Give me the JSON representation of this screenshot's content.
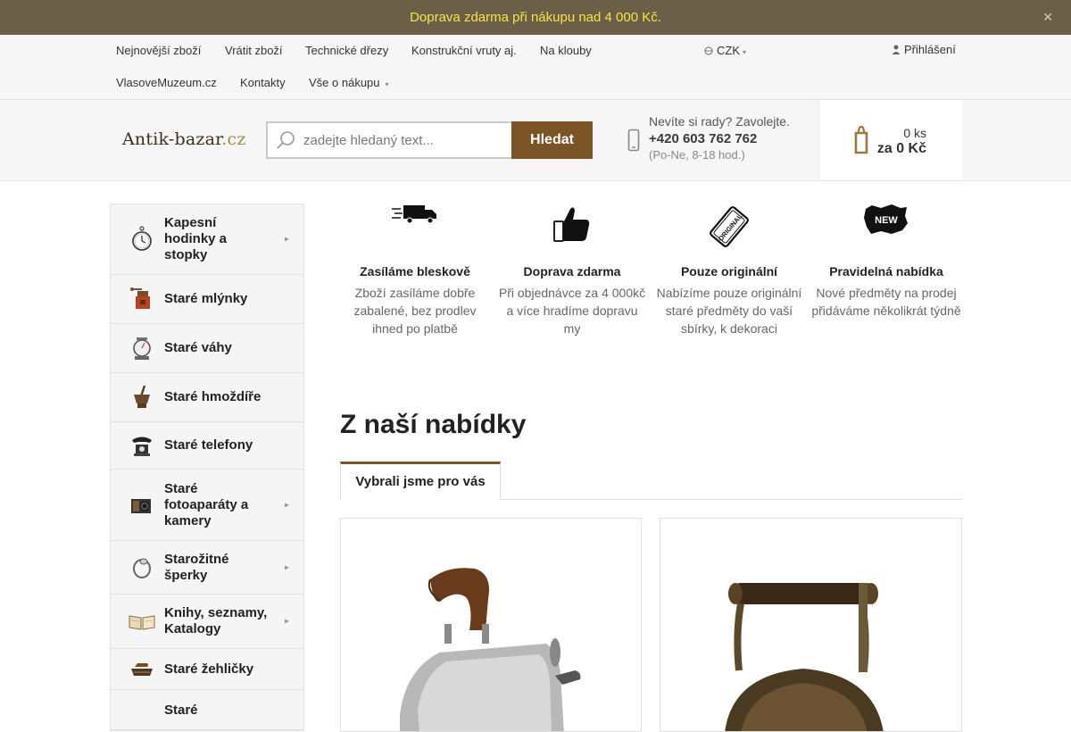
{
  "promo": {
    "text": "Doprava zdarma při nákupu nad 4 000 Kč.",
    "close": "✕"
  },
  "nav": {
    "row1": [
      "Nejnovější zboží",
      "Vrátit zboží",
      "Technické dřezy",
      "Konstrukční vruty aj.",
      "Na klouby"
    ],
    "row2": [
      "VlasoveMuzeum.cz",
      "Kontakty",
      "Vše o nákupu"
    ],
    "currency": "CZK",
    "login": "Přihlášení"
  },
  "header": {
    "logo_main": "Antik-bazar",
    "logo_tld": ".cz",
    "search_placeholder": "zadejte hledaný text...",
    "search_button": "Hledat",
    "contact_question": "Nevíte si rady? Zavolejte.",
    "contact_phone": "+420 603 762 762",
    "contact_hours": "(Po-Ne, 8-18 hod.)",
    "cart_count": "0 ks",
    "cart_total": "za 0 Kč"
  },
  "sidebar": {
    "items": [
      {
        "label": "Kapesní hodinky a stopky",
        "icon": "pocket-watch-icon",
        "submenu": true
      },
      {
        "label": "Staré mlýnky",
        "icon": "coffee-grinder-icon",
        "submenu": false
      },
      {
        "label": "Staré váhy",
        "icon": "scale-icon",
        "submenu": false
      },
      {
        "label": "Staré hmoždíře",
        "icon": "mortar-icon",
        "submenu": false
      },
      {
        "label": "Staré telefony",
        "icon": "telephone-icon",
        "submenu": false
      },
      {
        "label": "Staré fotoaparáty a kamery",
        "icon": "camera-icon",
        "submenu": true
      },
      {
        "label": "Starožitné šperky",
        "icon": "ring-icon",
        "submenu": true
      },
      {
        "label": "Knihy, seznamy, Katalogy",
        "icon": "book-icon",
        "submenu": true
      },
      {
        "label": "Staré žehličky",
        "icon": "iron-icon",
        "submenu": false
      },
      {
        "label": "Staré",
        "icon": "misc-icon",
        "submenu": false
      }
    ]
  },
  "benefits": [
    {
      "title": "Zasíláme bleskově",
      "desc": "Zboží zasíláme dobře zabalené, bez prodlev ihned po platbě",
      "icon": "truck-icon"
    },
    {
      "title": "Doprava zdarma",
      "desc": "Při objednávce za 4 000kč a více hradíme dopravu my",
      "icon": "thumbs-up-icon"
    },
    {
      "title": "Pouze originální",
      "desc": "Nabízíme pouze originální staré předměty do vaší sbírky, k dekoraci",
      "icon": "original-stamp-icon"
    },
    {
      "title": "Pravidelná nabídka",
      "desc": "Nové předměty na prodej přidáváme několikrát týdně",
      "icon": "new-badge-icon"
    }
  ],
  "offer": {
    "title": "Z naší nabídky",
    "tab": "Vybrali jsme pro vás"
  },
  "colors": {
    "accent": "#7a5424",
    "promo_bg": "#6b5f48",
    "promo_text": "#f4e44a"
  }
}
